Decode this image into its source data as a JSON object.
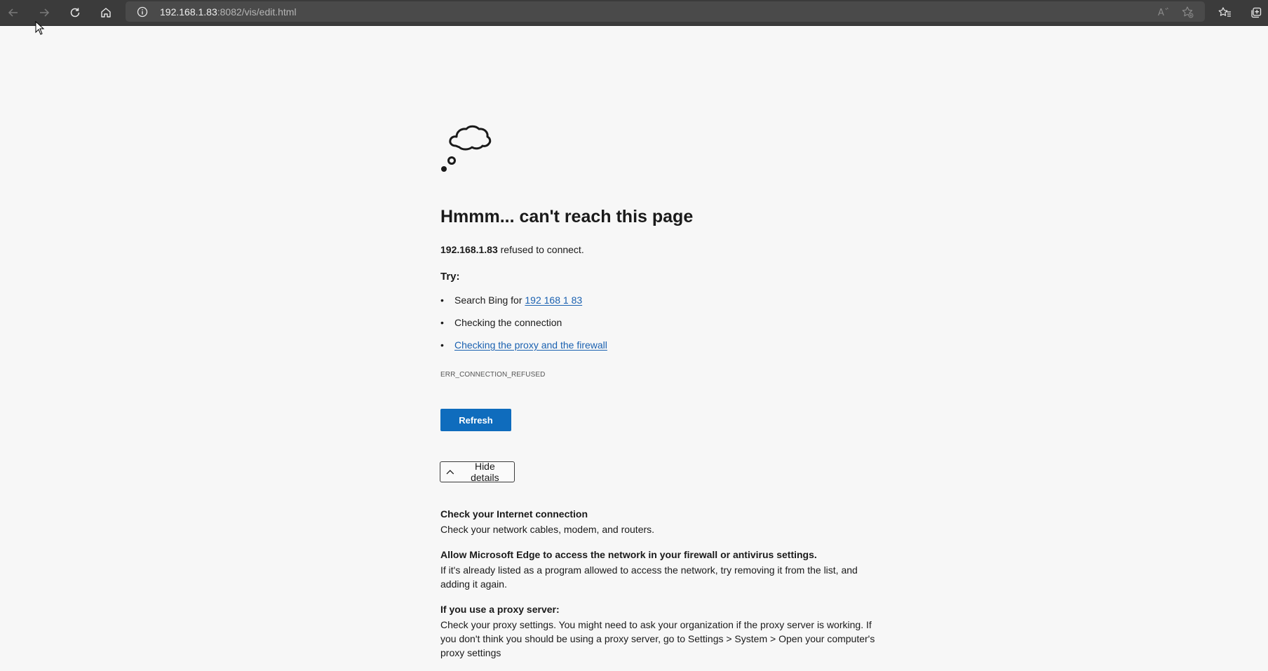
{
  "browser": {
    "url_host": "192.168.1.83",
    "url_path": ":8082/vis/edit.html",
    "icons": [
      "back-arrow-icon",
      "forward-arrow-icon",
      "reload-icon",
      "home-icon",
      "info-icon",
      "read-aloud-icon",
      "add-favorite-icon",
      "favorites-icon",
      "collections-icon"
    ]
  },
  "error_page": {
    "title": "Hmmm... can't reach this page",
    "host": "192.168.1.83",
    "refused_text": " refused to connect.",
    "try_label": "Try:",
    "suggestions": {
      "search_prefix": "Search Bing for ",
      "search_link": "192 168 1 83",
      "check_connection": "Checking the connection",
      "check_proxy": "Checking the proxy and the firewall"
    },
    "error_code": "ERR_CONNECTION_REFUSED",
    "refresh_label": "Refresh",
    "hide_details_label": "Hide details",
    "details": [
      {
        "title": "Check your Internet connection",
        "body": "Check your network cables, modem, and routers."
      },
      {
        "title": "Allow Microsoft Edge to access the network in your firewall or antivirus settings.",
        "body": "If it's already listed as a program allowed to access the network, try removing it from the list, and adding it again."
      },
      {
        "title": "If you use a proxy server:",
        "body": "Check your proxy settings. You might need to ask your organization if the proxy server is working. If you don't think you should be using a proxy server, go to Settings > System > Open your computer's proxy settings"
      }
    ]
  },
  "colors": {
    "accent": "#0f6cbd",
    "link": "#1960b0",
    "toolbar": "#3b3b3b"
  }
}
